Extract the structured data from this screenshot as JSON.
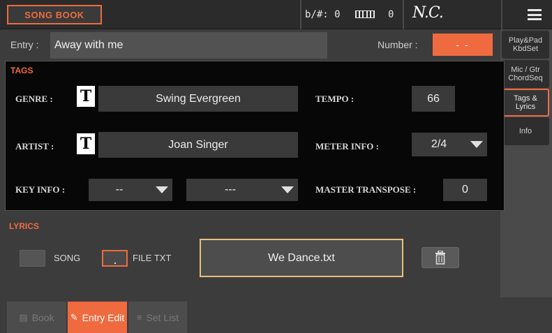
{
  "topbar": {
    "song_book_label": "SONG BOOK",
    "flat_sharp": "b/#: 0",
    "keyboard_value": "0",
    "chord": "N.C."
  },
  "entry": {
    "label": "Entry :",
    "value": "Away with me",
    "number_label": "Number :",
    "number_value": "- -"
  },
  "side_tabs": [
    {
      "label": "Play&Pad KbdSet"
    },
    {
      "label": "Mic / Gtr ChordSeq"
    },
    {
      "label": "Tags & Lyrics",
      "active": true
    },
    {
      "label": "Info"
    }
  ],
  "tags": {
    "title": "TAGS",
    "genre_label": "GENRE :",
    "genre_value": "Swing Evergreen",
    "artist_label": "ARTIST :",
    "artist_value": "Joan Singer",
    "key_info_label": "KEY INFO :",
    "key_info_value1": "--",
    "key_info_value2": "---",
    "tempo_label": "TEMPO :",
    "tempo_value": "66",
    "meter_label": "METER INFO :",
    "meter_value": "2/4",
    "master_transpose_label": "MASTER TRANSPOSE :",
    "master_transpose_value": "0",
    "t_icon": "T"
  },
  "lyrics": {
    "title": "LYRICS",
    "song_option": "SONG",
    "file_option": "FILE TXT",
    "file_name": "We Dance.txt"
  },
  "bottom_tabs": [
    {
      "label": "Book",
      "icon": "book-icon"
    },
    {
      "label": "Entry Edit",
      "icon": "pencil-icon",
      "active": true
    },
    {
      "label": "Set List",
      "icon": "list-icon"
    }
  ],
  "colors": {
    "accent": "#ef6b3f",
    "highlight": "#e8c17a",
    "panel": "#070707"
  }
}
